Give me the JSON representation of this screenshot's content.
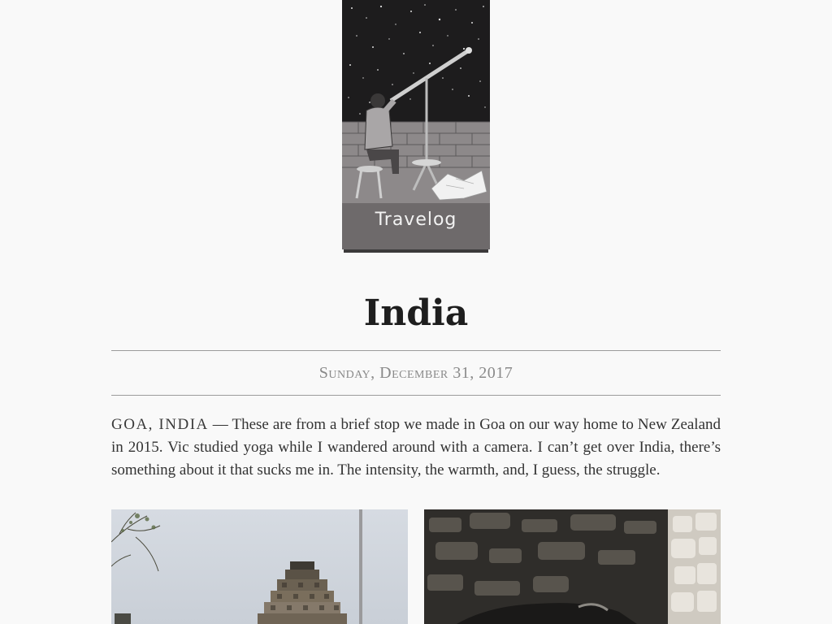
{
  "site": {
    "logo_title": "Travelog"
  },
  "post": {
    "title": "India",
    "date": "Sunday, December 31, 2017",
    "dateline": "GOA, INDIA",
    "separator": "—",
    "body": "These are from a brief stop we made in Goa on our way home to New Zealand in 2015. Vic studied yoga while I wandered around with a camera. I can’t get over India, there’s something about it that sucks me in. The intensity, the warmth, and, I guess, the struggle."
  },
  "photos": [
    {
      "icon": "temple-photo"
    },
    {
      "icon": "cow-photo"
    }
  ],
  "colors": {
    "background": "#f9f9f9",
    "text": "#2b2b2b",
    "muted": "#8a8a8a",
    "logo_card": "#6e6a6b",
    "rule": "#9c9c9c"
  }
}
